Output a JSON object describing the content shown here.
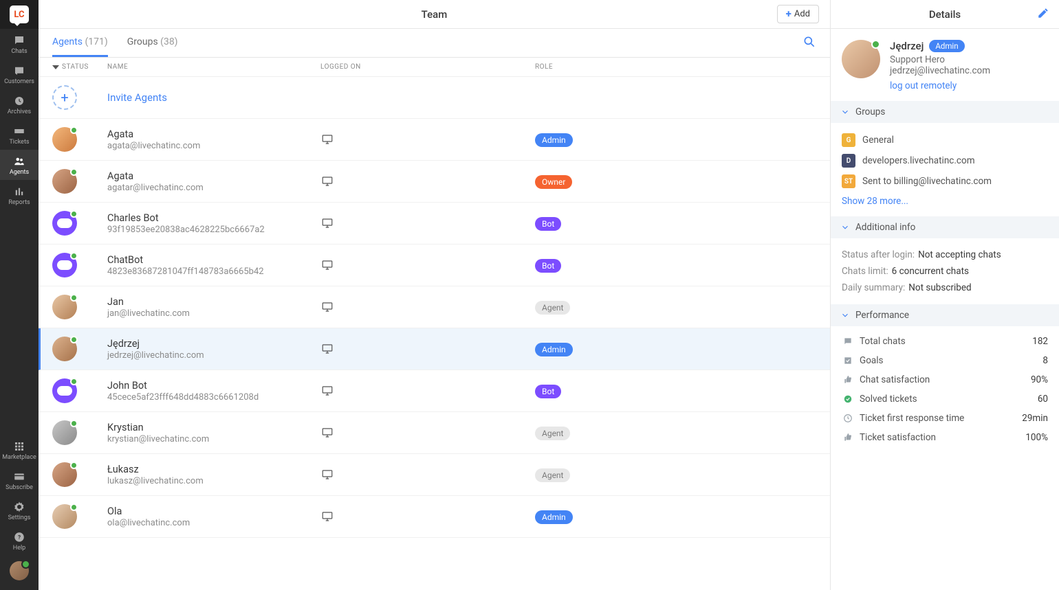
{
  "sidebar": {
    "logo_text": "LC",
    "items": [
      {
        "label": "Chats"
      },
      {
        "label": "Customers"
      },
      {
        "label": "Archives"
      },
      {
        "label": "Tickets"
      },
      {
        "label": "Agents"
      },
      {
        "label": "Reports"
      }
    ],
    "bottom": [
      {
        "label": "Marketplace"
      },
      {
        "label": "Subscribe"
      },
      {
        "label": "Settings"
      },
      {
        "label": "Help"
      }
    ]
  },
  "header": {
    "title": "Team",
    "add_label": "Add"
  },
  "tabs": {
    "agents_label": "Agents",
    "agents_count": "(171)",
    "groups_label": "Groups",
    "groups_count": "(38)"
  },
  "columns": {
    "status": "STATUS",
    "name": "NAME",
    "logged": "LOGGED ON",
    "role": "ROLE"
  },
  "invite": {
    "label": "Invite Agents"
  },
  "agents": [
    {
      "name": "Agata",
      "email": "agata@livechatinc.com",
      "role": "Admin",
      "role_class": "admin",
      "av": "g1"
    },
    {
      "name": "Agata",
      "email": "agatar@livechatinc.com",
      "role": "Owner",
      "role_class": "owner",
      "av": "g2"
    },
    {
      "name": "Charles Bot",
      "email": "93f19853ee20838ac4628225bc6667a2",
      "role": "Bot",
      "role_class": "bot",
      "av": "bot"
    },
    {
      "name": "ChatBot",
      "email": "4823e83687281047ff148783a6665b42",
      "role": "Bot",
      "role_class": "bot",
      "av": "bot"
    },
    {
      "name": "Jan",
      "email": "jan@livechatinc.com",
      "role": "Agent",
      "role_class": "agent",
      "av": "g3"
    },
    {
      "name": "Jędrzej",
      "email": "jedrzej@livechatinc.com",
      "role": "Admin",
      "role_class": "admin",
      "av": "g4",
      "selected": true
    },
    {
      "name": "John Bot",
      "email": "45cece5af23fff648dd4883c6661208d",
      "role": "Bot",
      "role_class": "bot",
      "av": "bot"
    },
    {
      "name": "Krystian",
      "email": "krystian@livechatinc.com",
      "role": "Agent",
      "role_class": "agent",
      "av": "g5"
    },
    {
      "name": "Łukasz",
      "email": "lukasz@livechatinc.com",
      "role": "Agent",
      "role_class": "agent",
      "av": "g2"
    },
    {
      "name": "Ola",
      "email": "ola@livechatinc.com",
      "role": "Admin",
      "role_class": "admin",
      "av": "g6"
    }
  ],
  "details": {
    "title": "Details",
    "name": "Jędrzej",
    "role": "Admin",
    "subtitle": "Support Hero",
    "email": "jedrzej@livechatinc.com",
    "logout_link": "log out remotely",
    "groups_head": "Groups",
    "groups": [
      {
        "chip": "G",
        "cls": "c1",
        "label": "General"
      },
      {
        "chip": "D",
        "cls": "c2",
        "label": "developers.livechatinc.com"
      },
      {
        "chip": "ST",
        "cls": "c3",
        "label": "Sent to billing@livechatinc.com"
      }
    ],
    "groups_more": "Show 28 more...",
    "info_head": "Additional info",
    "info": {
      "status_k": "Status after login:",
      "status_v": "Not accepting chats",
      "limit_k": "Chats limit:",
      "limit_v": "6 concurrent chats",
      "summary_k": "Daily summary:",
      "summary_v": "Not subscribed"
    },
    "perf_head": "Performance",
    "perf": [
      {
        "label": "Total chats",
        "value": "182",
        "icon": "chat"
      },
      {
        "label": "Goals",
        "value": "8",
        "icon": "check"
      },
      {
        "label": "Chat satisfaction",
        "value": "90%",
        "icon": "thumb"
      },
      {
        "label": "Solved tickets",
        "value": "60",
        "icon": "circle-check"
      },
      {
        "label": "Ticket first response time",
        "value": "29min",
        "icon": "clock"
      },
      {
        "label": "Ticket satisfaction",
        "value": "100%",
        "icon": "thumb"
      }
    ]
  }
}
